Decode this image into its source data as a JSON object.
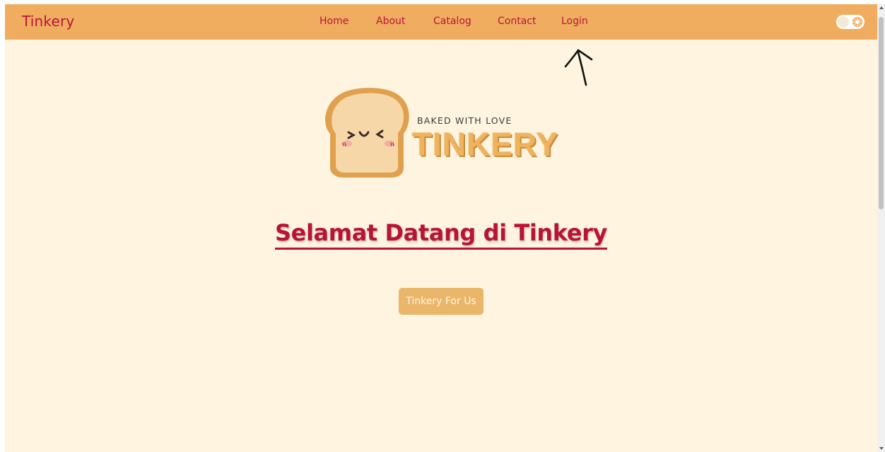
{
  "navbar": {
    "brand": "Tinkery",
    "links": [
      "Home",
      "About",
      "Catalog",
      "Contact",
      "Login"
    ]
  },
  "logo": {
    "tagline": "BAKED WITH LOVE",
    "wordmark": "TINKERY"
  },
  "hero": {
    "title": "Selamat Datang di Tinkery",
    "button_label": "Tinkery For Us"
  },
  "icons": {
    "theme_toggle": "theme-toggle-sun-icon",
    "annotation": "arrow-up-icon",
    "logo_mascot": "toast-mascot-icon"
  },
  "colors": {
    "navbar_bg": "#f0ad60",
    "page_bg": "#fff4e0",
    "accent": "#b81438",
    "button_bg": "#e9b66a"
  }
}
